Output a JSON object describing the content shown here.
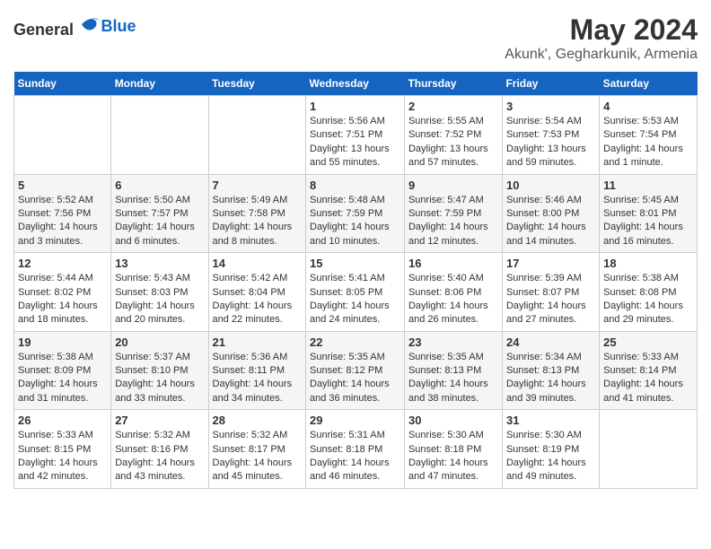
{
  "header": {
    "logo_general": "General",
    "logo_blue": "Blue",
    "month": "May 2024",
    "location": "Akunk', Gegharkunik, Armenia"
  },
  "weekdays": [
    "Sunday",
    "Monday",
    "Tuesday",
    "Wednesday",
    "Thursday",
    "Friday",
    "Saturday"
  ],
  "weeks": [
    [
      {
        "day": "",
        "info": ""
      },
      {
        "day": "",
        "info": ""
      },
      {
        "day": "",
        "info": ""
      },
      {
        "day": "1",
        "info": "Sunrise: 5:56 AM\nSunset: 7:51 PM\nDaylight: 13 hours and 55 minutes."
      },
      {
        "day": "2",
        "info": "Sunrise: 5:55 AM\nSunset: 7:52 PM\nDaylight: 13 hours and 57 minutes."
      },
      {
        "day": "3",
        "info": "Sunrise: 5:54 AM\nSunset: 7:53 PM\nDaylight: 13 hours and 59 minutes."
      },
      {
        "day": "4",
        "info": "Sunrise: 5:53 AM\nSunset: 7:54 PM\nDaylight: 14 hours and 1 minute."
      }
    ],
    [
      {
        "day": "5",
        "info": "Sunrise: 5:52 AM\nSunset: 7:56 PM\nDaylight: 14 hours and 3 minutes."
      },
      {
        "day": "6",
        "info": "Sunrise: 5:50 AM\nSunset: 7:57 PM\nDaylight: 14 hours and 6 minutes."
      },
      {
        "day": "7",
        "info": "Sunrise: 5:49 AM\nSunset: 7:58 PM\nDaylight: 14 hours and 8 minutes."
      },
      {
        "day": "8",
        "info": "Sunrise: 5:48 AM\nSunset: 7:59 PM\nDaylight: 14 hours and 10 minutes."
      },
      {
        "day": "9",
        "info": "Sunrise: 5:47 AM\nSunset: 7:59 PM\nDaylight: 14 hours and 12 minutes."
      },
      {
        "day": "10",
        "info": "Sunrise: 5:46 AM\nSunset: 8:00 PM\nDaylight: 14 hours and 14 minutes."
      },
      {
        "day": "11",
        "info": "Sunrise: 5:45 AM\nSunset: 8:01 PM\nDaylight: 14 hours and 16 minutes."
      }
    ],
    [
      {
        "day": "12",
        "info": "Sunrise: 5:44 AM\nSunset: 8:02 PM\nDaylight: 14 hours and 18 minutes."
      },
      {
        "day": "13",
        "info": "Sunrise: 5:43 AM\nSunset: 8:03 PM\nDaylight: 14 hours and 20 minutes."
      },
      {
        "day": "14",
        "info": "Sunrise: 5:42 AM\nSunset: 8:04 PM\nDaylight: 14 hours and 22 minutes."
      },
      {
        "day": "15",
        "info": "Sunrise: 5:41 AM\nSunset: 8:05 PM\nDaylight: 14 hours and 24 minutes."
      },
      {
        "day": "16",
        "info": "Sunrise: 5:40 AM\nSunset: 8:06 PM\nDaylight: 14 hours and 26 minutes."
      },
      {
        "day": "17",
        "info": "Sunrise: 5:39 AM\nSunset: 8:07 PM\nDaylight: 14 hours and 27 minutes."
      },
      {
        "day": "18",
        "info": "Sunrise: 5:38 AM\nSunset: 8:08 PM\nDaylight: 14 hours and 29 minutes."
      }
    ],
    [
      {
        "day": "19",
        "info": "Sunrise: 5:38 AM\nSunset: 8:09 PM\nDaylight: 14 hours and 31 minutes."
      },
      {
        "day": "20",
        "info": "Sunrise: 5:37 AM\nSunset: 8:10 PM\nDaylight: 14 hours and 33 minutes."
      },
      {
        "day": "21",
        "info": "Sunrise: 5:36 AM\nSunset: 8:11 PM\nDaylight: 14 hours and 34 minutes."
      },
      {
        "day": "22",
        "info": "Sunrise: 5:35 AM\nSunset: 8:12 PM\nDaylight: 14 hours and 36 minutes."
      },
      {
        "day": "23",
        "info": "Sunrise: 5:35 AM\nSunset: 8:13 PM\nDaylight: 14 hours and 38 minutes."
      },
      {
        "day": "24",
        "info": "Sunrise: 5:34 AM\nSunset: 8:13 PM\nDaylight: 14 hours and 39 minutes."
      },
      {
        "day": "25",
        "info": "Sunrise: 5:33 AM\nSunset: 8:14 PM\nDaylight: 14 hours and 41 minutes."
      }
    ],
    [
      {
        "day": "26",
        "info": "Sunrise: 5:33 AM\nSunset: 8:15 PM\nDaylight: 14 hours and 42 minutes."
      },
      {
        "day": "27",
        "info": "Sunrise: 5:32 AM\nSunset: 8:16 PM\nDaylight: 14 hours and 43 minutes."
      },
      {
        "day": "28",
        "info": "Sunrise: 5:32 AM\nSunset: 8:17 PM\nDaylight: 14 hours and 45 minutes."
      },
      {
        "day": "29",
        "info": "Sunrise: 5:31 AM\nSunset: 8:18 PM\nDaylight: 14 hours and 46 minutes."
      },
      {
        "day": "30",
        "info": "Sunrise: 5:30 AM\nSunset: 8:18 PM\nDaylight: 14 hours and 47 minutes."
      },
      {
        "day": "31",
        "info": "Sunrise: 5:30 AM\nSunset: 8:19 PM\nDaylight: 14 hours and 49 minutes."
      },
      {
        "day": "",
        "info": ""
      }
    ]
  ]
}
